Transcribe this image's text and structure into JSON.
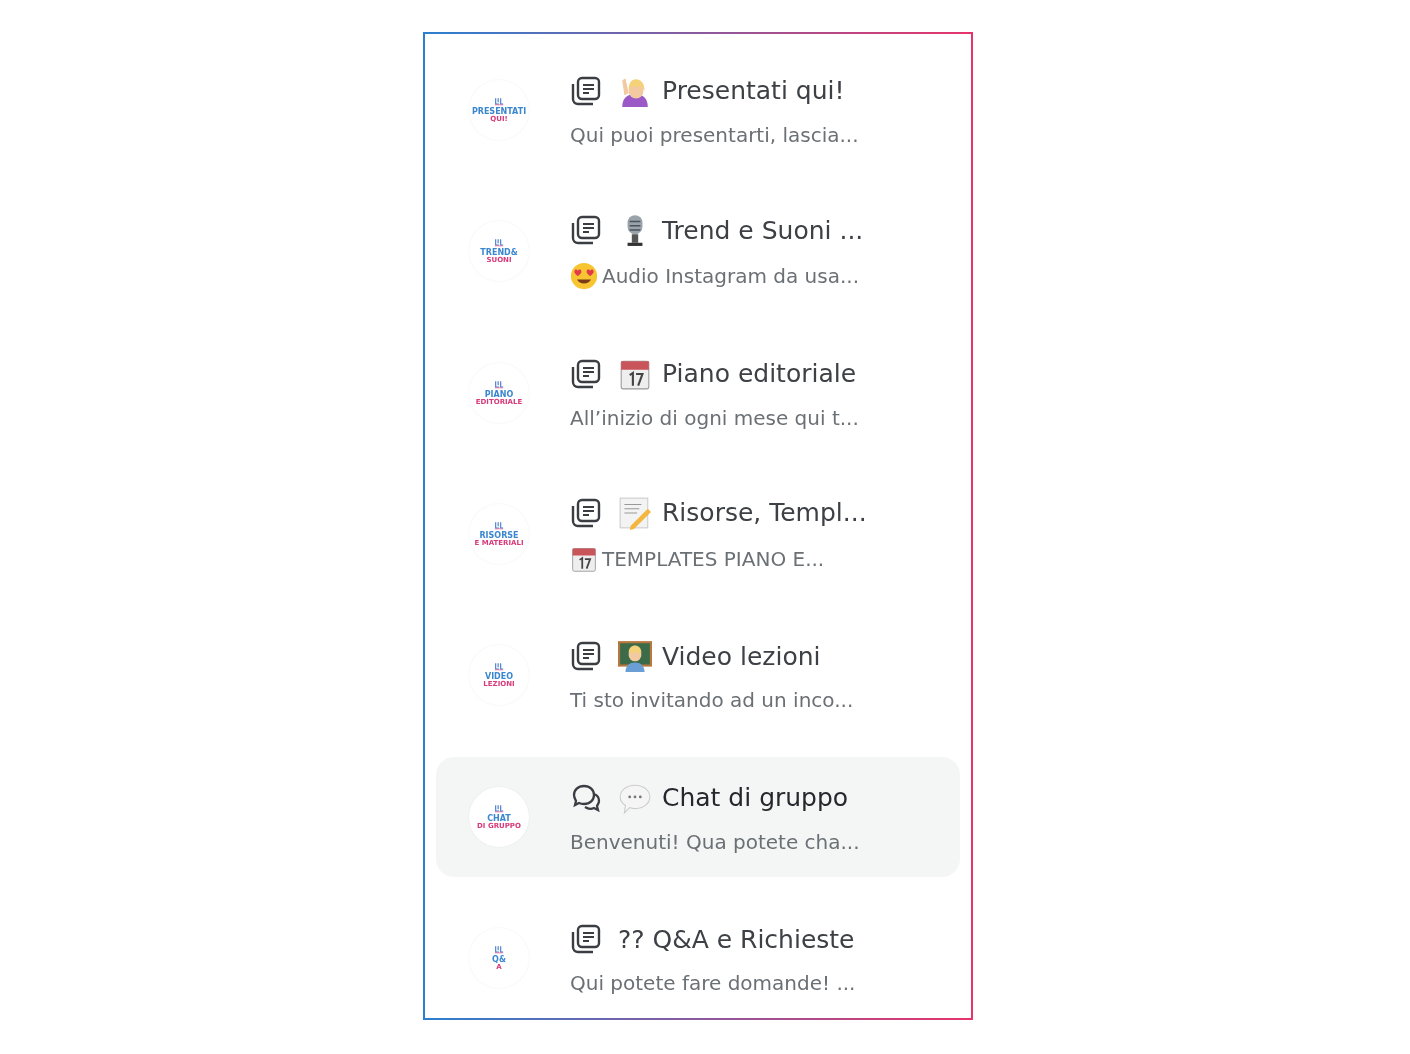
{
  "channels": [
    {
      "kind": "posts",
      "selected": false,
      "avatar": [
        "PRESENTATI",
        "QUI!"
      ],
      "emoji": {
        "kind": "hand"
      },
      "title": "Presentati qui!",
      "description": "Qui puoi presentarti, lascia..."
    },
    {
      "kind": "posts",
      "selected": false,
      "avatar": [
        "TREND&",
        "SUONI"
      ],
      "emoji": {
        "kind": "microphone"
      },
      "title": "Trend e Suoni ...",
      "desc_emoji": {
        "kind": "heart-eyes"
      },
      "description": "Audio Instagram da usa..."
    },
    {
      "kind": "posts",
      "selected": false,
      "avatar": [
        "PIANO",
        "EDITORIALE"
      ],
      "emoji": {
        "kind": "calendar"
      },
      "title": "Piano editoriale",
      "description": "All’inizio di ogni mese qui t..."
    },
    {
      "kind": "posts",
      "selected": false,
      "avatar": [
        "RISORSE",
        "E MATERIALI"
      ],
      "emoji": {
        "kind": "memo"
      },
      "title": "Risorse, Templ...",
      "desc_emoji": {
        "kind": "calendar"
      },
      "description": "TEMPLATES PIANO E..."
    },
    {
      "kind": "posts",
      "selected": false,
      "avatar": [
        "VIDEO",
        "LEZIONI"
      ],
      "emoji": {
        "kind": "teacher"
      },
      "title": "Video lezioni",
      "description": "Ti sto invitando ad un inco..."
    },
    {
      "kind": "chat",
      "selected": true,
      "avatar": [
        "CHAT",
        "DI GRUPPO"
      ],
      "emoji": {
        "kind": "speech"
      },
      "title": "Chat di gruppo",
      "description": "Benvenuti! Qua potete cha..."
    },
    {
      "kind": "posts",
      "selected": false,
      "avatar": [
        "Q&",
        "A"
      ],
      "title": "?? Q&A e Richieste",
      "description": "Qui potete fare domande! ..."
    }
  ]
}
